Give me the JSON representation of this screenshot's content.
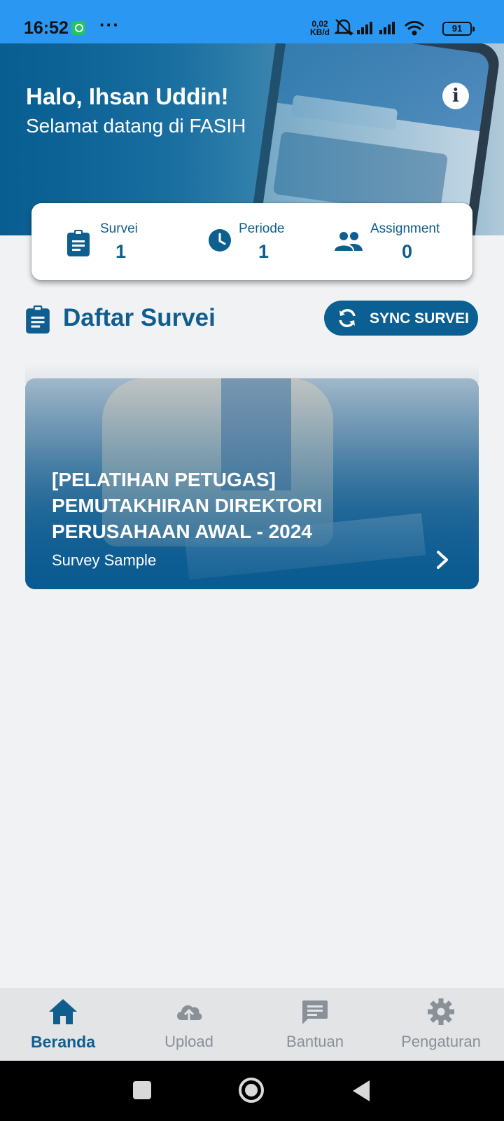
{
  "status_bar": {
    "time": "16:52",
    "net_speed_value": "0,02",
    "net_speed_unit": "KB/d",
    "battery": "91"
  },
  "header": {
    "greeting": "Halo, Ihsan Uddin!",
    "subtitle": "Selamat datang di FASIH",
    "info_icon": "i"
  },
  "stats": [
    {
      "label": "Survei",
      "value": "1",
      "icon": "clipboard-icon"
    },
    {
      "label": "Periode",
      "value": "1",
      "icon": "clock-icon"
    },
    {
      "label": "Assignment",
      "value": "0",
      "icon": "people-icon"
    }
  ],
  "section": {
    "title": "Daftar Survei",
    "sync_label": "SYNC SURVEI"
  },
  "survey_card": {
    "title": "[PELATIHAN PETUGAS] PEMUTAKHIRAN DIREKTORI PERUSAHAAN AWAL - 2024",
    "subtitle": "Survey Sample"
  },
  "bottom_nav": [
    {
      "label": "Beranda",
      "icon": "home-icon",
      "active": true
    },
    {
      "label": "Upload",
      "icon": "cloud-upload-icon",
      "active": false
    },
    {
      "label": "Bantuan",
      "icon": "chat-icon",
      "active": false
    },
    {
      "label": "Pengaturan",
      "icon": "gear-icon",
      "active": false
    }
  ],
  "colors": {
    "status_bar": "#2a97f2",
    "primary": "#0f5e8f",
    "background": "#f1f2f3",
    "nav_inactive": "#8a9098"
  }
}
